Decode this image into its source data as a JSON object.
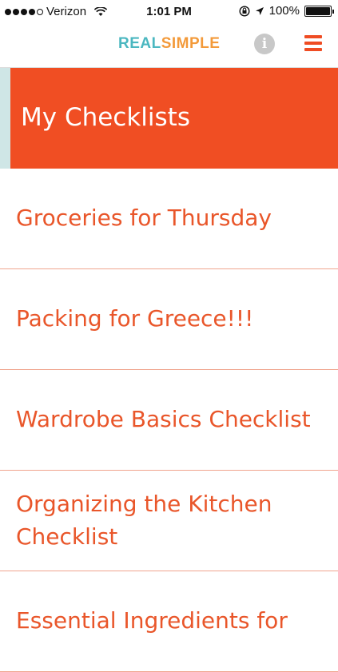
{
  "status_bar": {
    "carrier": "Verizon",
    "time": "1:01 PM",
    "battery": "100%",
    "icons": [
      "signal-icon",
      "wifi-icon",
      "rotation-lock-icon",
      "location-arrow-icon",
      "battery-icon"
    ]
  },
  "nav": {
    "logo_part1": "REAL",
    "logo_part2": "SIMPLE",
    "info_glyph": "i",
    "colors": {
      "logo_real": "#4bb7c0",
      "logo_simple": "#f39a3a",
      "accent": "#ef4c23"
    }
  },
  "header": {
    "title": "My Checklists",
    "color": "#f04e23"
  },
  "checklists": [
    {
      "label": "Groceries for Thursday"
    },
    {
      "label": "Packing for Greece!!!"
    },
    {
      "label": "Wardrobe Basics Checklist"
    },
    {
      "label": "Organizing the Kitchen Checklist"
    },
    {
      "label": "Essential Ingredients for"
    }
  ]
}
